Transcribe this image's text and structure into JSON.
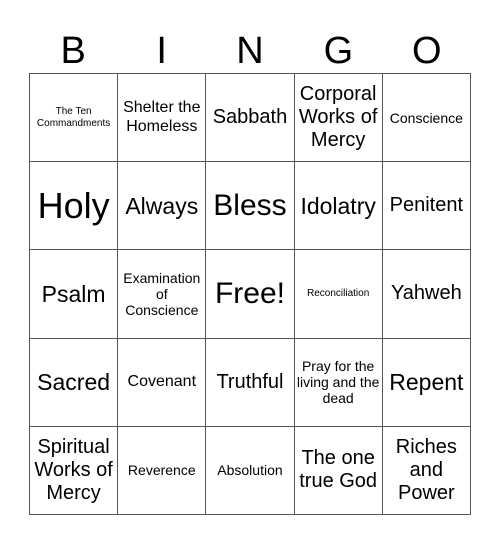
{
  "header": [
    "B",
    "I",
    "N",
    "G",
    "O"
  ],
  "cells": [
    [
      {
        "text": "The Ten Commandments",
        "size": "xs"
      },
      {
        "text": "Shelter the Homeless",
        "size": "md"
      },
      {
        "text": "Sabbath",
        "size": "lg"
      },
      {
        "text": "Corporal Works of Mercy",
        "size": "lg"
      },
      {
        "text": "Conscience",
        "size": "sm"
      }
    ],
    [
      {
        "text": "Holy",
        "size": "huge"
      },
      {
        "text": "Always",
        "size": "xl"
      },
      {
        "text": "Bless",
        "size": "xxl"
      },
      {
        "text": "Idolatry",
        "size": "xl"
      },
      {
        "text": "Penitent",
        "size": "lg"
      }
    ],
    [
      {
        "text": "Psalm",
        "size": "xl"
      },
      {
        "text": "Examination of Conscience",
        "size": "sm"
      },
      {
        "text": "Free!",
        "size": "xxl"
      },
      {
        "text": "Reconciliation",
        "size": "xs"
      },
      {
        "text": "Yahweh",
        "size": "lg"
      }
    ],
    [
      {
        "text": "Sacred",
        "size": "xl"
      },
      {
        "text": "Covenant",
        "size": "md"
      },
      {
        "text": "Truthful",
        "size": "lg"
      },
      {
        "text": "Pray for the living and the dead",
        "size": "sm"
      },
      {
        "text": "Repent",
        "size": "xl"
      }
    ],
    [
      {
        "text": "Spiritual Works of Mercy",
        "size": "lg"
      },
      {
        "text": "Reverence",
        "size": "sm"
      },
      {
        "text": "Absolution",
        "size": "sm"
      },
      {
        "text": "The one true God",
        "size": "lg"
      },
      {
        "text": "Riches and Power",
        "size": "lg"
      }
    ]
  ]
}
